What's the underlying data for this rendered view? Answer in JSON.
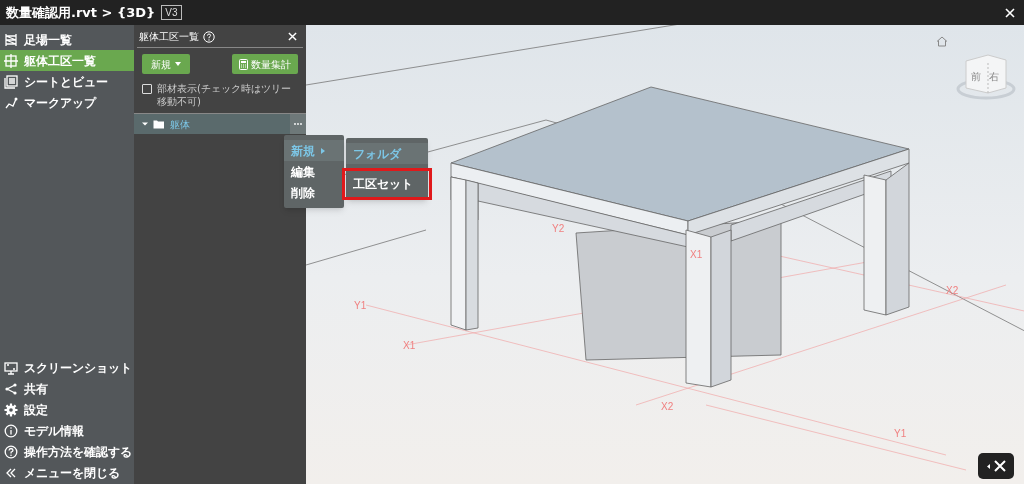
{
  "window": {
    "title": "数量確認用.rvt > {3D}",
    "version": "V3"
  },
  "sidebar": {
    "items": [
      {
        "label": "足場一覧",
        "selected": false
      },
      {
        "label": "躯体工区一覧",
        "selected": true
      },
      {
        "label": "シートとビュー",
        "selected": false
      },
      {
        "label": "マークアップ",
        "selected": false
      }
    ],
    "bottom_items": [
      {
        "label": "スクリーンショット"
      },
      {
        "label": "共有"
      },
      {
        "label": "設定"
      },
      {
        "label": "モデル情報"
      },
      {
        "label": "操作方法を確認する"
      },
      {
        "label": "メニューを閉じる"
      }
    ]
  },
  "panel": {
    "title": "躯体工区一覧",
    "new_button": "新規",
    "summary_button": "数量集計",
    "checkbox": {
      "label": "部材表示(チェック時はツリー移動不可)",
      "checked": false
    },
    "tree": [
      {
        "label": "躯体",
        "expanded": true
      }
    ],
    "context_menu": [
      {
        "label": "新規",
        "selected": true,
        "has_submenu": true
      },
      {
        "label": "編集",
        "selected": false,
        "has_submenu": false
      },
      {
        "label": "削除",
        "selected": false,
        "has_submenu": false
      }
    ],
    "submenu": [
      {
        "label": "フォルダ",
        "selected": true,
        "highlighted": false
      },
      {
        "label": "工区セット",
        "selected": false,
        "highlighted": true
      }
    ]
  },
  "viewport": {
    "viewcube_faces": [
      "前",
      "右"
    ],
    "grid_labels": [
      "Y2",
      "X1",
      "Y1",
      "X1",
      "X2",
      "X2",
      "Y1"
    ]
  }
}
